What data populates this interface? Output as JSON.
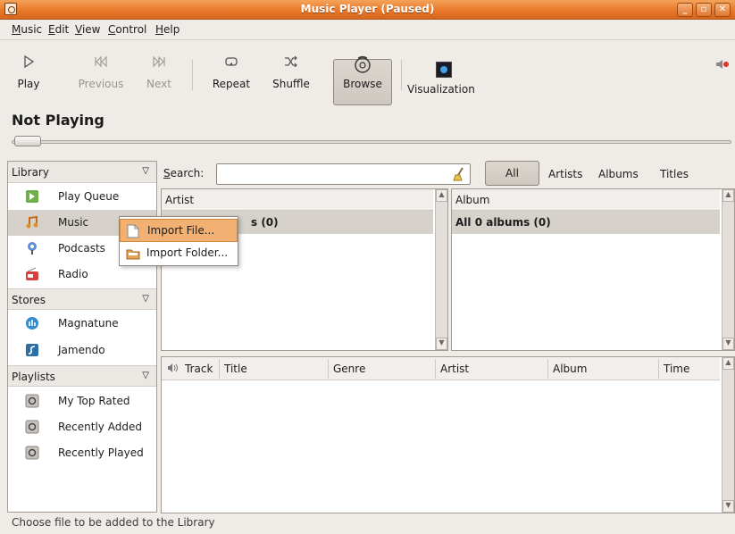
{
  "window": {
    "title": "Music Player (Paused)"
  },
  "menubar": {
    "items": [
      {
        "label": "Music",
        "mnemonic": "M"
      },
      {
        "label": "Edit",
        "mnemonic": "E"
      },
      {
        "label": "View",
        "mnemonic": "V"
      },
      {
        "label": "Control",
        "mnemonic": "C"
      },
      {
        "label": "Help",
        "mnemonic": "H"
      }
    ]
  },
  "toolbar": {
    "play": "Play",
    "previous": "Previous",
    "next": "Next",
    "repeat": "Repeat",
    "shuffle": "Shuffle",
    "browse": "Browse",
    "visualization": "Visualization"
  },
  "now_playing": "Not Playing",
  "sidebar": {
    "sections": [
      {
        "header": "Library",
        "items": [
          {
            "label": "Play Queue",
            "icon": "play-queue-icon"
          },
          {
            "label": "Music",
            "icon": "music-icon",
            "selected": true
          },
          {
            "label": "Podcasts",
            "icon": "podcast-icon"
          },
          {
            "label": "Radio",
            "icon": "radio-icon"
          }
        ]
      },
      {
        "header": "Stores",
        "items": [
          {
            "label": "Magnatune",
            "icon": "magnatune-icon"
          },
          {
            "label": "Jamendo",
            "icon": "jamendo-icon"
          }
        ]
      },
      {
        "header": "Playlists",
        "items": [
          {
            "label": "My Top Rated",
            "icon": "smart-playlist-icon"
          },
          {
            "label": "Recently Added",
            "icon": "smart-playlist-icon"
          },
          {
            "label": "Recently Played",
            "icon": "smart-playlist-icon"
          }
        ]
      }
    ]
  },
  "search": {
    "label": "Search:",
    "value": "",
    "filters": [
      "All",
      "Artists",
      "Albums",
      "Titles"
    ],
    "selected_filter": "All"
  },
  "artist_panel": {
    "header": "Artist",
    "all_row": "s (0)"
  },
  "album_panel": {
    "header": "Album",
    "all_row": "All 0 albums (0)"
  },
  "track_list": {
    "columns": [
      "Track",
      "Title",
      "Genre",
      "Artist",
      "Album",
      "Time"
    ]
  },
  "context_menu": {
    "items": [
      {
        "label": "Import File...",
        "highlighted": true
      },
      {
        "label": "Import Folder...",
        "highlighted": false
      }
    ]
  },
  "status": "Choose file to be added to the Library",
  "colors": {
    "titlebar": "#e8782a",
    "selection": "#d6d1cb",
    "menu_highlight": "#f2b072"
  }
}
